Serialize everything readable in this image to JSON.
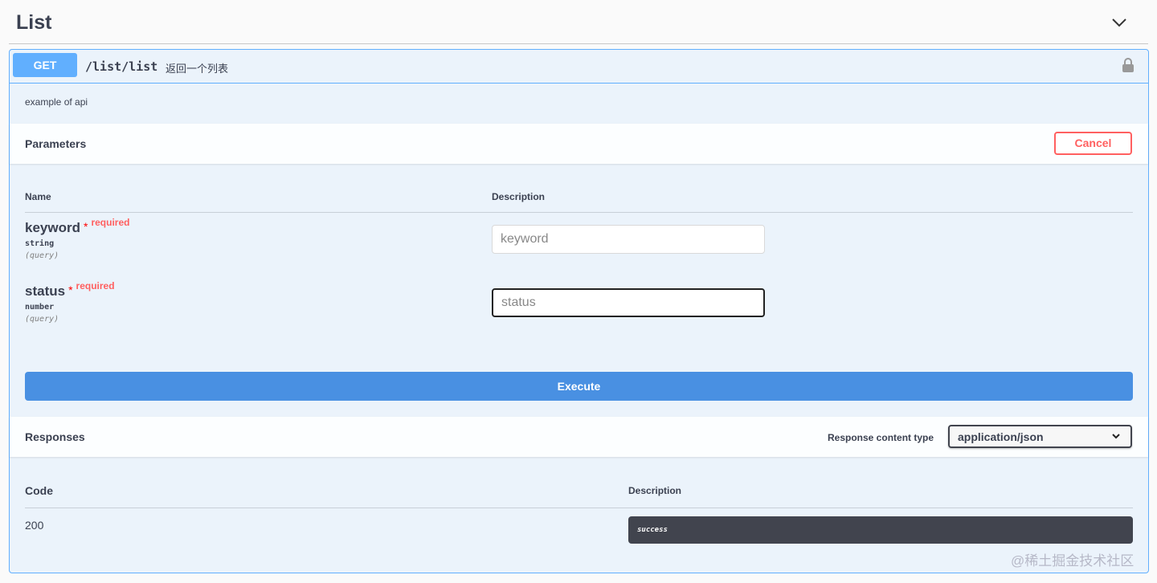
{
  "section": {
    "title": "List"
  },
  "operation": {
    "method": "GET",
    "path": "/list/list",
    "summary": "返回一个列表",
    "description": "example of api"
  },
  "parameters": {
    "title": "Parameters",
    "cancel_label": "Cancel",
    "col_name": "Name",
    "col_description": "Description",
    "items": [
      {
        "name": "keyword",
        "star": "*",
        "required": "required",
        "type": "string",
        "in": "(query)",
        "placeholder": "keyword"
      },
      {
        "name": "status",
        "star": "*",
        "required": "required",
        "type": "number",
        "in": "(query)",
        "placeholder": "status"
      }
    ],
    "execute_label": "Execute"
  },
  "responses": {
    "title": "Responses",
    "content_type_label": "Response content type",
    "content_type": "application/json",
    "col_code": "Code",
    "col_description": "Description",
    "items": [
      {
        "code": "200",
        "description": "success"
      }
    ]
  },
  "watermark": "@稀土掘金技术社区"
}
